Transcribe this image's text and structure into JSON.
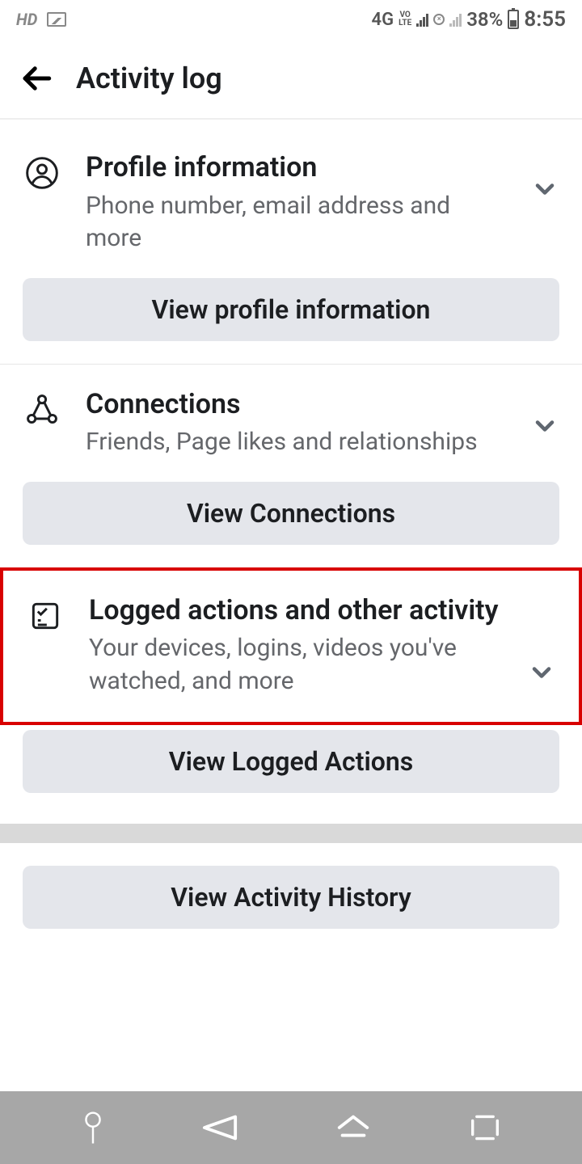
{
  "status": {
    "hd": "HD",
    "network": "4G",
    "battery_pct": "38%",
    "time": "8:55"
  },
  "header": {
    "title": "Activity log"
  },
  "sections": {
    "profile": {
      "title": "Profile information",
      "subtitle": "Phone number, email address and more",
      "button": "View profile information"
    },
    "connections": {
      "title": "Connections",
      "subtitle": "Friends, Page likes and relationships",
      "button": "View Connections"
    },
    "logged": {
      "title": "Logged actions and other activity",
      "subtitle": "Your devices, logins, videos you've watched, and more",
      "button": "View Logged Actions"
    },
    "history": {
      "button": "View Activity History"
    }
  }
}
